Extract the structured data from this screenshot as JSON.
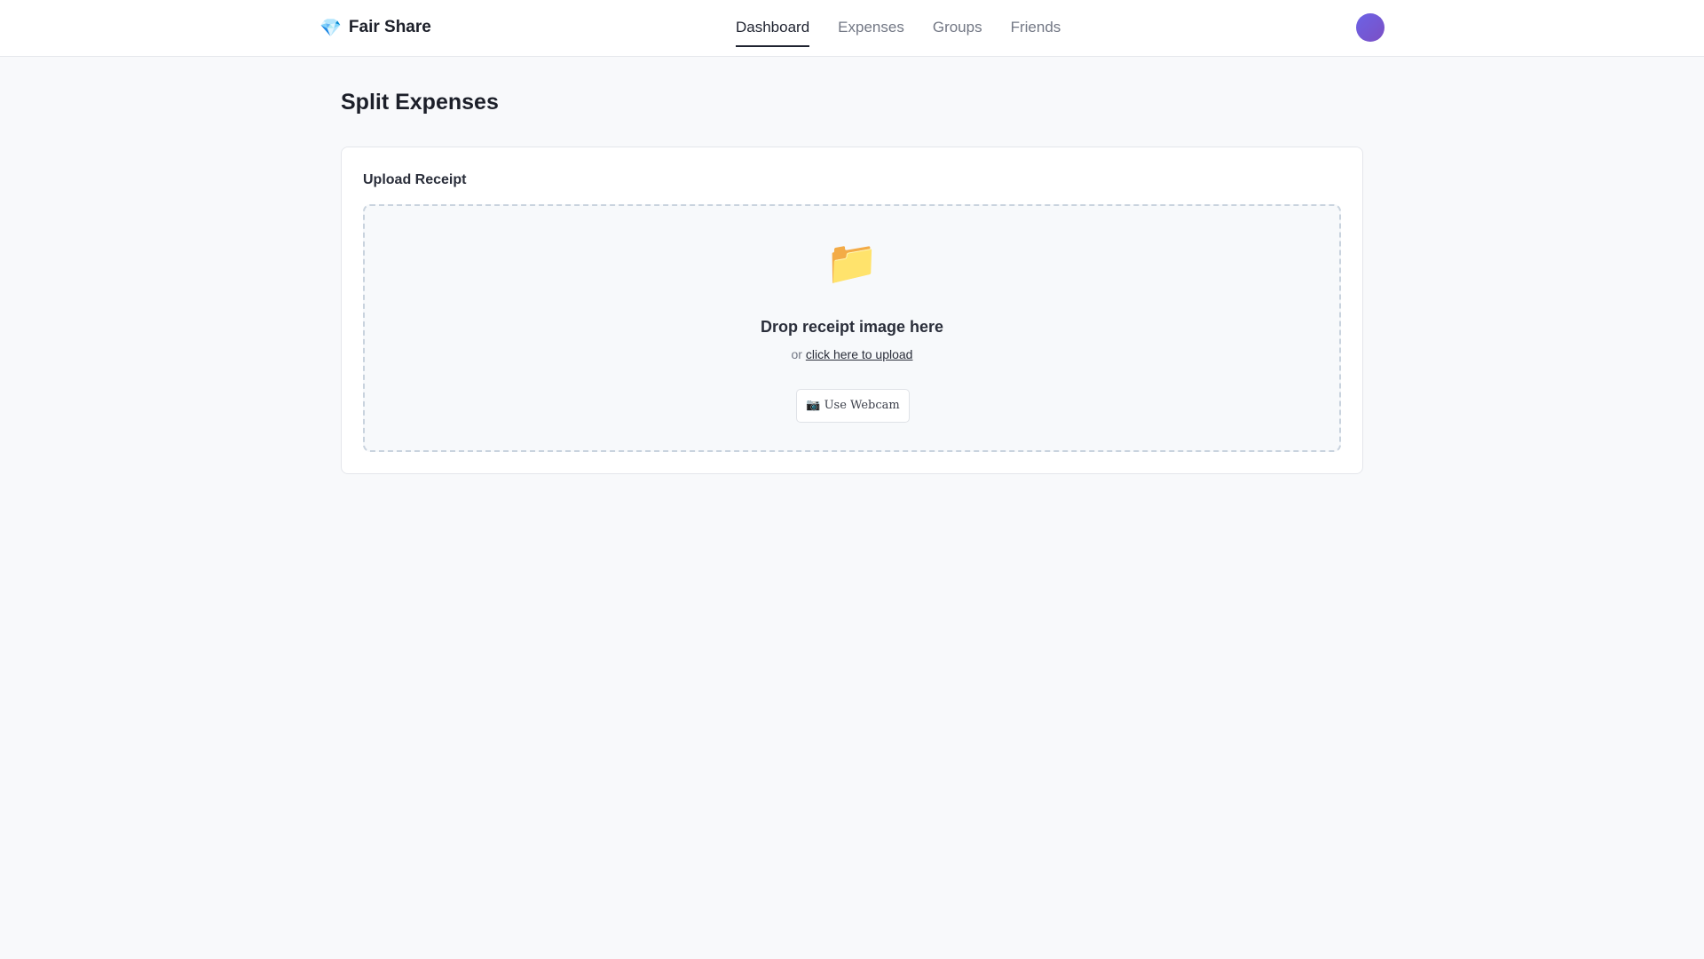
{
  "header": {
    "brand_icon": "💎",
    "brand_icon_name": "gem-icon",
    "brand_name": "Fair Share",
    "nav": [
      {
        "label": "Dashboard",
        "active": true
      },
      {
        "label": "Expenses",
        "active": false
      },
      {
        "label": "Groups",
        "active": false
      },
      {
        "label": "Friends",
        "active": false
      }
    ],
    "avatar_color": "#6c63e6"
  },
  "main": {
    "title": "Split Expenses",
    "upload_card": {
      "title": "Upload Receipt",
      "folder_icon": "📁",
      "folder_icon_name": "folder-icon",
      "drop_heading": "Drop receipt image here",
      "or_text": "or",
      "upload_link": "click here to upload",
      "webcam_button": "📷 Use Webcam",
      "webcam_icon_name": "camera-icon"
    }
  },
  "colors": {
    "background": "#f8f9fb",
    "accent": "#1f2330",
    "dropzone_border": "#c9d3de"
  }
}
